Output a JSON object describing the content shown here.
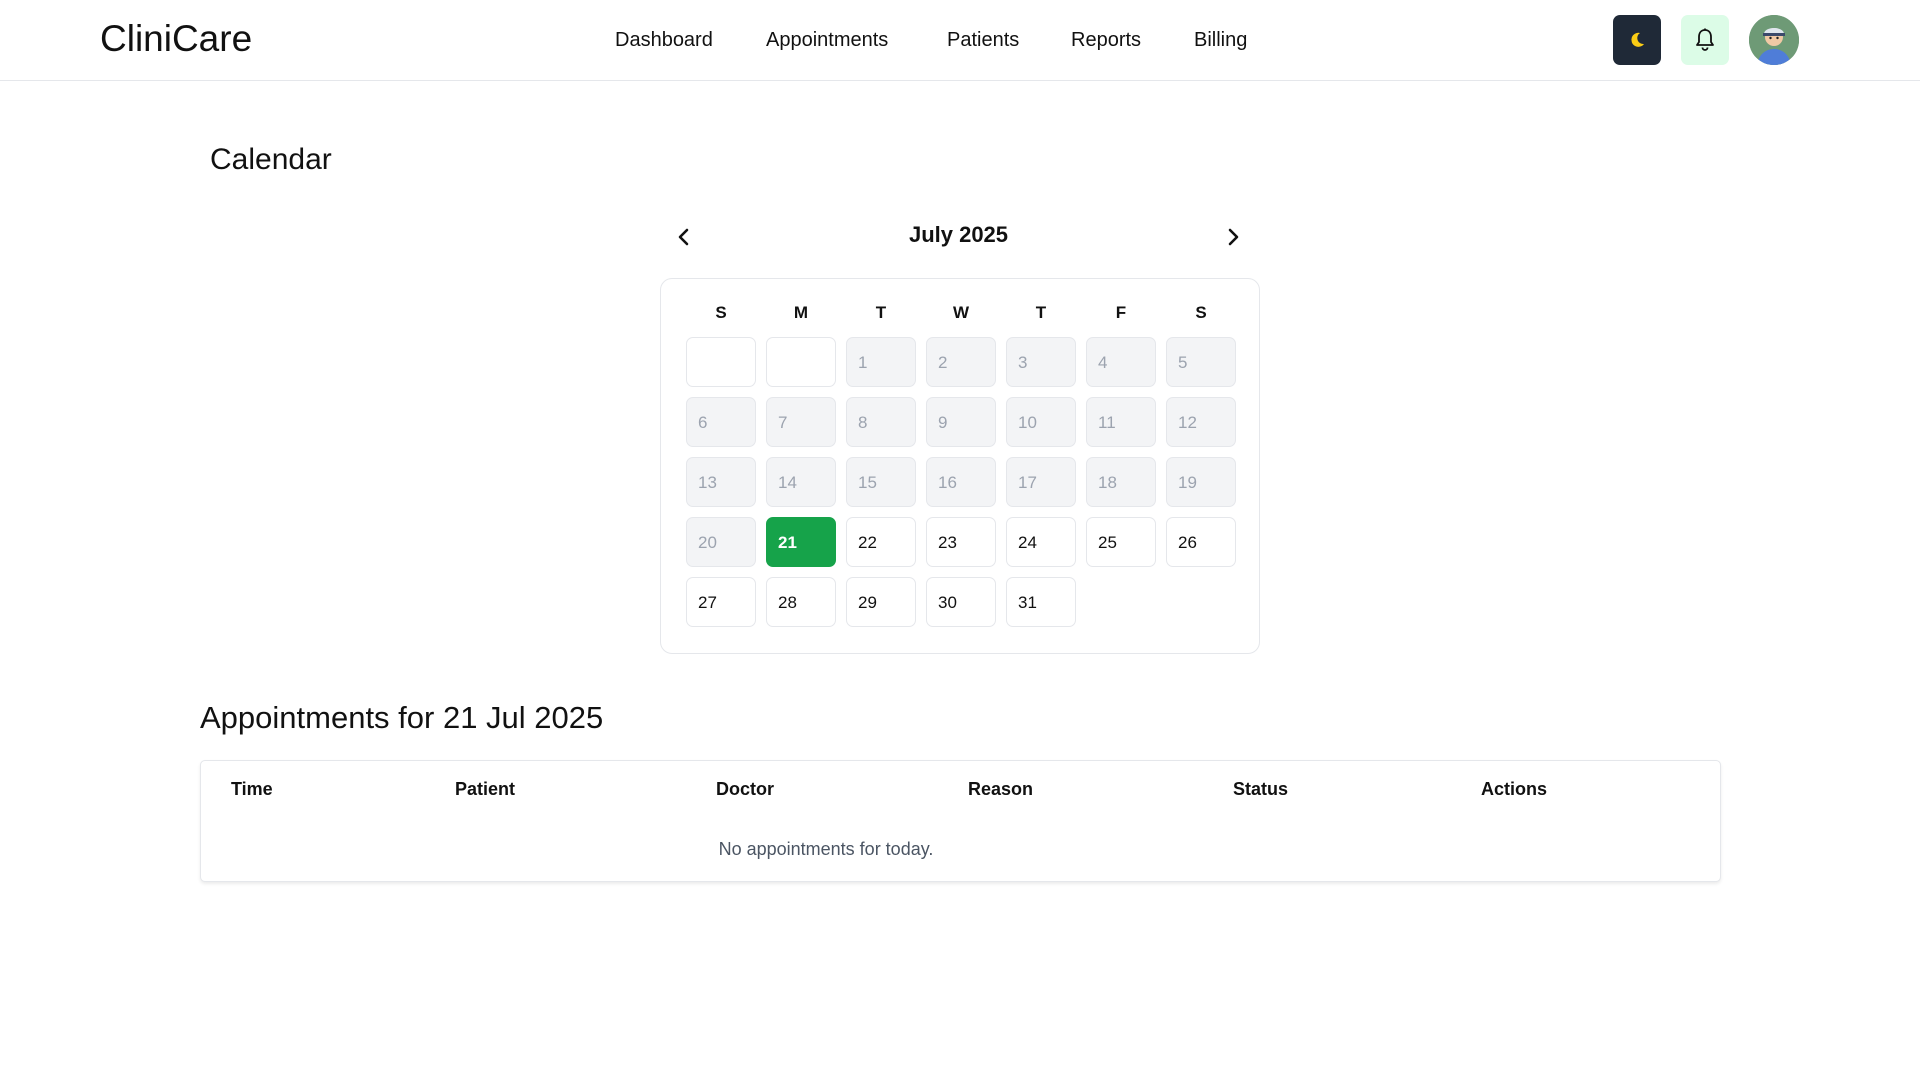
{
  "app": {
    "name": "CliniCare"
  },
  "nav": {
    "items": [
      {
        "label": "Dashboard"
      },
      {
        "label": "Appointments"
      },
      {
        "label": "Patients"
      },
      {
        "label": "Reports"
      },
      {
        "label": "Billing"
      }
    ]
  },
  "header_actions": {
    "theme_toggle_icon": "moon-icon",
    "notifications_icon": "bell-icon",
    "avatar_icon": "user-avatar"
  },
  "page": {
    "title": "Calendar"
  },
  "calendar": {
    "month_label": "July 2025",
    "weekdays": [
      "S",
      "M",
      "T",
      "W",
      "T",
      "F",
      "S"
    ],
    "leading_blanks": 2,
    "days": [
      "1",
      "2",
      "3",
      "4",
      "5",
      "6",
      "7",
      "8",
      "9",
      "10",
      "11",
      "12",
      "13",
      "14",
      "15",
      "16",
      "17",
      "18",
      "19",
      "20",
      "21",
      "22",
      "23",
      "24",
      "25",
      "26",
      "27",
      "28",
      "29",
      "30",
      "31"
    ],
    "selected_day": "21",
    "past_days_through": 20,
    "colors": {
      "selected": "#16a34a",
      "past_bg": "#f3f4f6",
      "past_text": "#9ca3af"
    }
  },
  "appointments": {
    "title": "Appointments for 21 Jul 2025",
    "columns": [
      "Time",
      "Patient",
      "Doctor",
      "Reason",
      "Status",
      "Actions"
    ],
    "rows": [],
    "empty_message": "No appointments for today."
  }
}
